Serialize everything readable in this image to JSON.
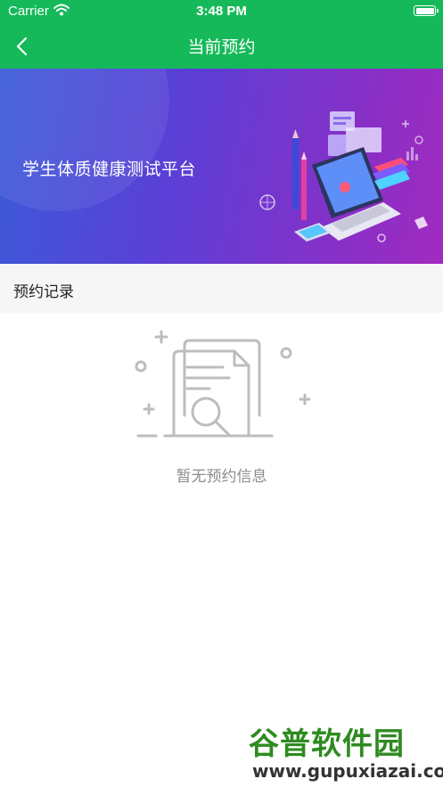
{
  "status_bar": {
    "carrier": "Carrier",
    "time": "3:48 PM"
  },
  "nav": {
    "title": "当前预约",
    "back_icon": "chevron-left-icon"
  },
  "banner": {
    "title": "学生体质健康测试平台"
  },
  "section": {
    "label": "预约记录"
  },
  "empty_state": {
    "icon": "document-search-icon",
    "message": "暂无预约信息"
  },
  "watermark": {
    "main": "谷普软件园",
    "url": "www.gupuxiazai.com"
  },
  "colors": {
    "primary_green": "#16b95a",
    "banner_start": "#3b5bd9",
    "banner_end": "#a12bc0",
    "section_bg": "#f6f6f6",
    "empty_text": "#8c8c8c"
  }
}
